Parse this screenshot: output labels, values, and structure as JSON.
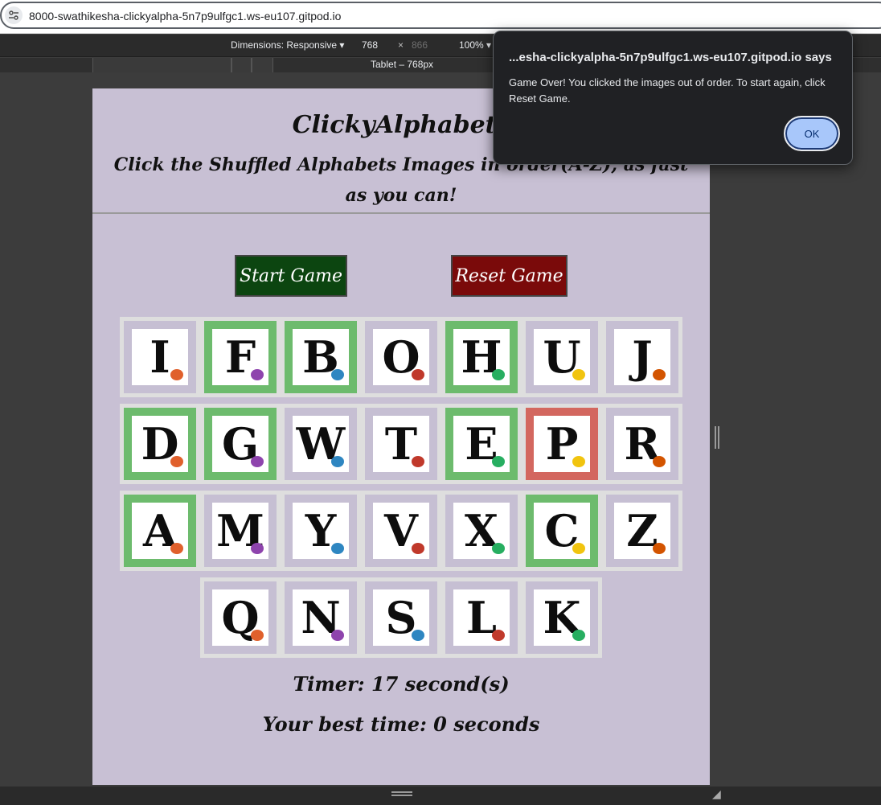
{
  "browser": {
    "url": "8000-swathikesha-clickyalpha-5n7p9ulfgc1.ws-eu107.gitpod.io",
    "site_info_icon": "tune-icon"
  },
  "devtools": {
    "dimensions_label": "Dimensions: Responsive",
    "width": "768",
    "times": "×",
    "height": "866",
    "zoom": "100%",
    "device_label": "Tablet – 768px"
  },
  "page": {
    "title": "ClickyAlphabets",
    "subtitle": "Click the Shuffled Alphabets Images in order(A-Z), as fast as you can!",
    "start_label": "Start Game",
    "reset_label": "Reset Game",
    "timer_text": "Timer: 17 second(s)",
    "best_text": "Your best time: 0 seconds",
    "colors": {
      "background": "#c8c0d4",
      "green_tile": "#6dbb6d",
      "red_tile": "#d3675f",
      "start": "#0c4510",
      "reset": "#7a0a0a"
    },
    "rows": [
      [
        {
          "letter": "I",
          "state": "none"
        },
        {
          "letter": "F",
          "state": "green"
        },
        {
          "letter": "B",
          "state": "green"
        },
        {
          "letter": "O",
          "state": "none"
        },
        {
          "letter": "H",
          "state": "green"
        },
        {
          "letter": "U",
          "state": "none"
        },
        {
          "letter": "J",
          "state": "none"
        }
      ],
      [
        {
          "letter": "D",
          "state": "green"
        },
        {
          "letter": "G",
          "state": "green"
        },
        {
          "letter": "W",
          "state": "none"
        },
        {
          "letter": "T",
          "state": "none"
        },
        {
          "letter": "E",
          "state": "green"
        },
        {
          "letter": "P",
          "state": "red"
        },
        {
          "letter": "R",
          "state": "none"
        }
      ],
      [
        {
          "letter": "A",
          "state": "green"
        },
        {
          "letter": "M",
          "state": "none"
        },
        {
          "letter": "Y",
          "state": "none"
        },
        {
          "letter": "V",
          "state": "none"
        },
        {
          "letter": "X",
          "state": "none"
        },
        {
          "letter": "C",
          "state": "green"
        },
        {
          "letter": "Z",
          "state": "none"
        }
      ],
      [
        {
          "letter": "Q",
          "state": "none"
        },
        {
          "letter": "N",
          "state": "none"
        },
        {
          "letter": "S",
          "state": "none"
        },
        {
          "letter": "L",
          "state": "none"
        },
        {
          "letter": "K",
          "state": "none"
        }
      ]
    ]
  },
  "dialog": {
    "title": "...esha-clickyalpha-5n7p9ulfgc1.ws-eu107.gitpod.io says",
    "message": "Game Over! You clicked the images out of order. To start again, click Reset Game.",
    "ok_label": "OK"
  }
}
